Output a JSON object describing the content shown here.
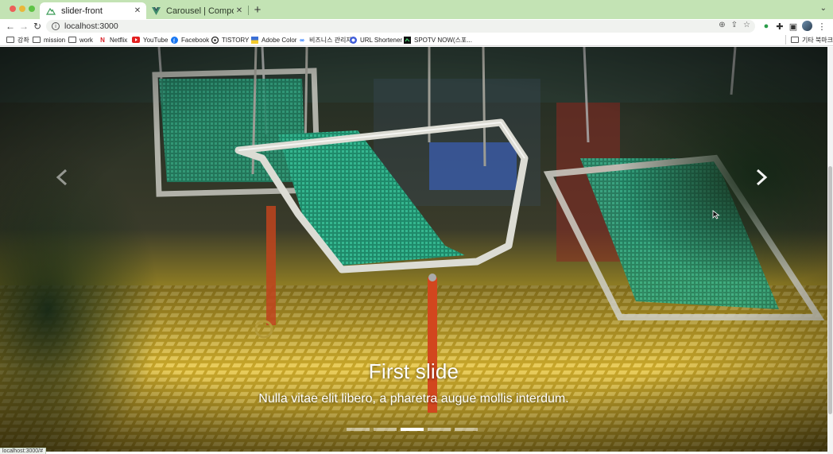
{
  "browser": {
    "tabs": [
      {
        "title": "slider-front",
        "active": true
      },
      {
        "title": "Carousel | Components | Bootst",
        "active": false
      }
    ],
    "new_tab_label": "+",
    "url": "localhost:3000",
    "bookmarks": [
      {
        "label": "강좌",
        "icon": "folder-icon"
      },
      {
        "label": "mission",
        "icon": "folder-icon"
      },
      {
        "label": "work",
        "icon": "folder-icon"
      },
      {
        "label": "Netflix",
        "icon": "netflix-icon"
      },
      {
        "label": "YouTube",
        "icon": "youtube-icon"
      },
      {
        "label": "Facebook",
        "icon": "facebook-icon"
      },
      {
        "label": "TISTORY",
        "icon": "tistory-icon"
      },
      {
        "label": "Adobe Color",
        "icon": "adobe-color-icon"
      },
      {
        "label": "비즈니스 관리자",
        "icon": "meta-icon"
      },
      {
        "label": "URL Shortener",
        "icon": "url-shortener-icon"
      },
      {
        "label": "SPOTV NOW(스포...",
        "icon": "spotv-icon"
      }
    ],
    "other_bookmarks": "기타 북마크",
    "status_url": "localhost:3000/#"
  },
  "carousel": {
    "slide_title": "First slide",
    "slide_text": "Nulla vitae elit libero, a pharetra augue mollis interdum.",
    "indicator_count": 5,
    "active_indicator": 3
  },
  "colors": {
    "tabbar": "#c3e3b4",
    "seat_green": "#2aa37f",
    "ground_yellow": "#d8b52c"
  }
}
